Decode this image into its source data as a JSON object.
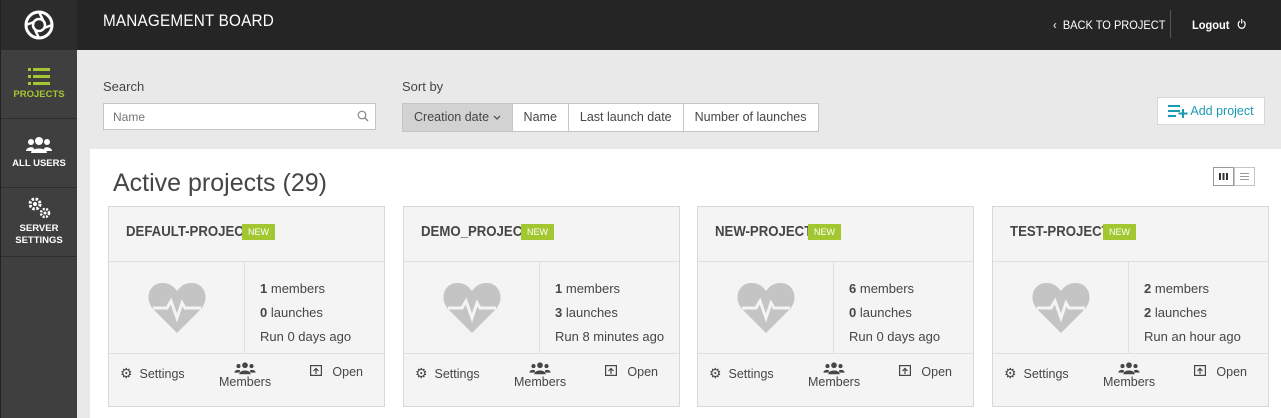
{
  "sidebar": {
    "items": [
      {
        "label": "PROJECTS"
      },
      {
        "label": "ALL USERS"
      },
      {
        "label_line1": "SERVER",
        "label_line2": "SETTINGS"
      }
    ]
  },
  "header": {
    "title": "MANAGEMENT BOARD",
    "back_label": "BACK TO PROJECT",
    "logout_label": "Logout"
  },
  "filters": {
    "search_label": "Search",
    "search_placeholder": "Name",
    "sort_label": "Sort by",
    "sort_options": [
      "Creation date",
      "Name",
      "Last launch date",
      "Number of launches"
    ],
    "add_label": "Add project"
  },
  "main": {
    "title": "Active projects (29)"
  },
  "projects": [
    {
      "name": "DEFAULT-PROJECT",
      "badge": "NEW",
      "members_count": "1",
      "members_text": "members",
      "launches_count": "0",
      "launches_text": "launches",
      "last_run": "Run 0 days ago",
      "settings": "Settings",
      "members": "Members",
      "open": "Open"
    },
    {
      "name": "DEMO_PROJECT",
      "badge": "NEW",
      "members_count": "1",
      "members_text": "members",
      "launches_count": "3",
      "launches_text": "launches",
      "last_run": "Run 8 minutes ago",
      "settings": "Settings",
      "members": "Members",
      "open": "Open"
    },
    {
      "name": "NEW-PROJECT",
      "badge": "NEW",
      "members_count": "6",
      "members_text": "members",
      "launches_count": "0",
      "launches_text": "launches",
      "last_run": "Run 0 days ago",
      "settings": "Settings",
      "members": "Members",
      "open": "Open"
    },
    {
      "name": "TEST-PROJECT",
      "badge": "NEW",
      "members_count": "2",
      "members_text": "members",
      "launches_count": "2",
      "launches_text": "launches",
      "last_run": "Run an hour ago",
      "settings": "Settings",
      "members": "Members",
      "open": "Open"
    }
  ],
  "colors": {
    "accent": "#a2c730",
    "link": "#1a9cb0",
    "topbar": "#252525",
    "sidebar": "#3f3f3f"
  },
  "icons": [
    "logo-aperture-icon",
    "list-icon",
    "users-icon",
    "gears-icon",
    "chevron-left-icon",
    "power-icon",
    "search-icon",
    "chevron-down-icon",
    "add-list-icon",
    "grid-view-icon",
    "list-view-icon",
    "heartbeat-icon",
    "gear-icon",
    "members-icon",
    "open-icon"
  ]
}
